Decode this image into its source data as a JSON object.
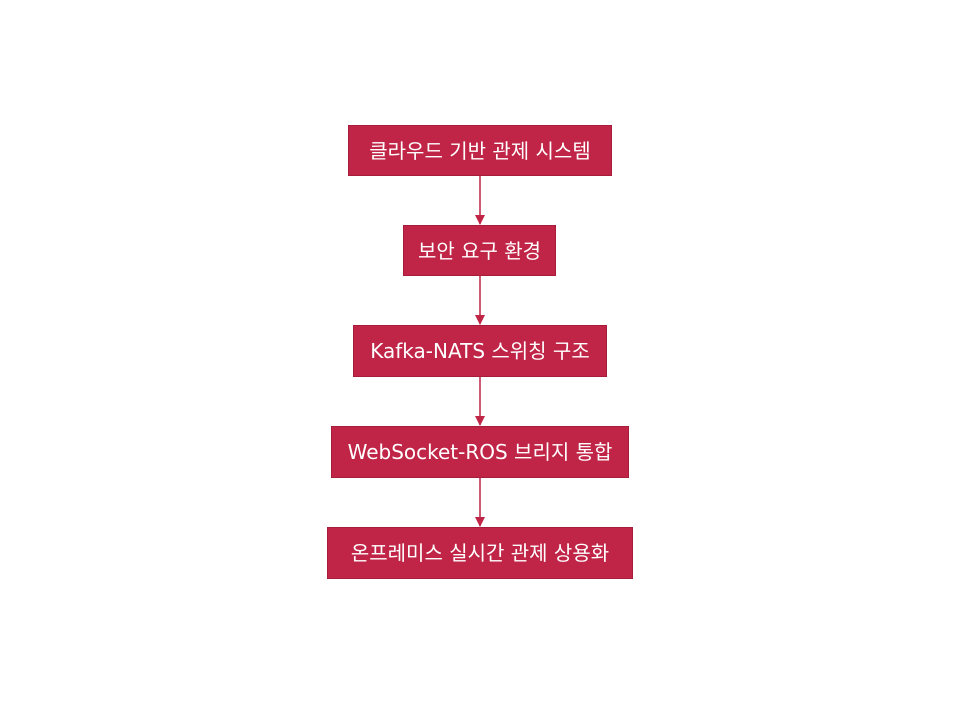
{
  "diagram": {
    "type": "flowchart",
    "direction": "top-to-bottom",
    "colors": {
      "node_fill": "#c02446",
      "node_text": "#ffffff",
      "edge": "#c02446"
    },
    "nodes": [
      {
        "id": "n1",
        "label": "클라우드 기반 관제 시스템"
      },
      {
        "id": "n2",
        "label": "보안 요구 환경"
      },
      {
        "id": "n3",
        "label": "Kafka-NATS 스위칭 구조"
      },
      {
        "id": "n4",
        "label": "WebSocket-ROS 브리지 통합"
      },
      {
        "id": "n5",
        "label": "온프레미스 실시간 관제 상용화"
      }
    ],
    "edges": [
      {
        "from": "n1",
        "to": "n2"
      },
      {
        "from": "n2",
        "to": "n3"
      },
      {
        "from": "n3",
        "to": "n4"
      },
      {
        "from": "n4",
        "to": "n5"
      }
    ]
  }
}
